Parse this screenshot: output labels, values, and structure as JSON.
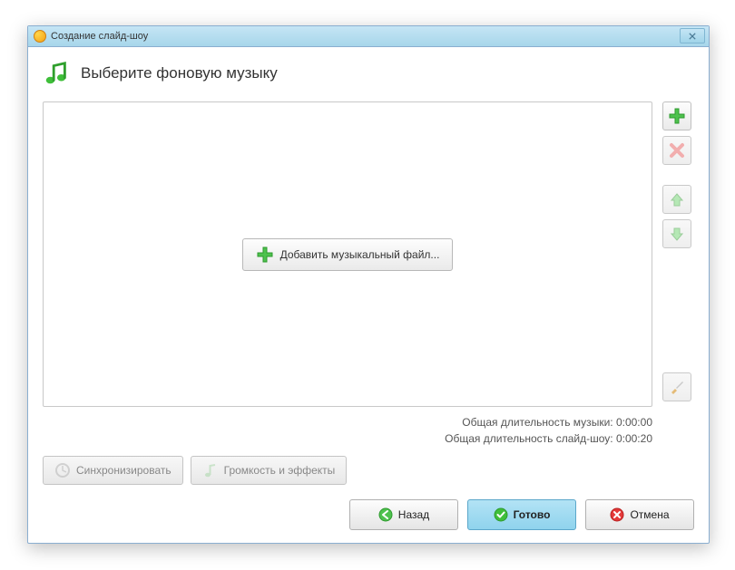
{
  "titlebar": {
    "title": "Создание слайд-шоу"
  },
  "header": {
    "title": "Выберите фоновую музыку"
  },
  "main": {
    "add_music_label": "Добавить музыкальный файл..."
  },
  "duration": {
    "music_label": "Общая длительность музыки:",
    "music_value": "0:00:00",
    "slideshow_label": "Общая длительность слайд-шоу:",
    "slideshow_value": "0:00:20"
  },
  "options": {
    "sync_label": "Синхронизировать",
    "volume_label": "Громкость и эффекты"
  },
  "footer": {
    "back_label": "Назад",
    "done_label": "Готово",
    "cancel_label": "Отмена"
  }
}
